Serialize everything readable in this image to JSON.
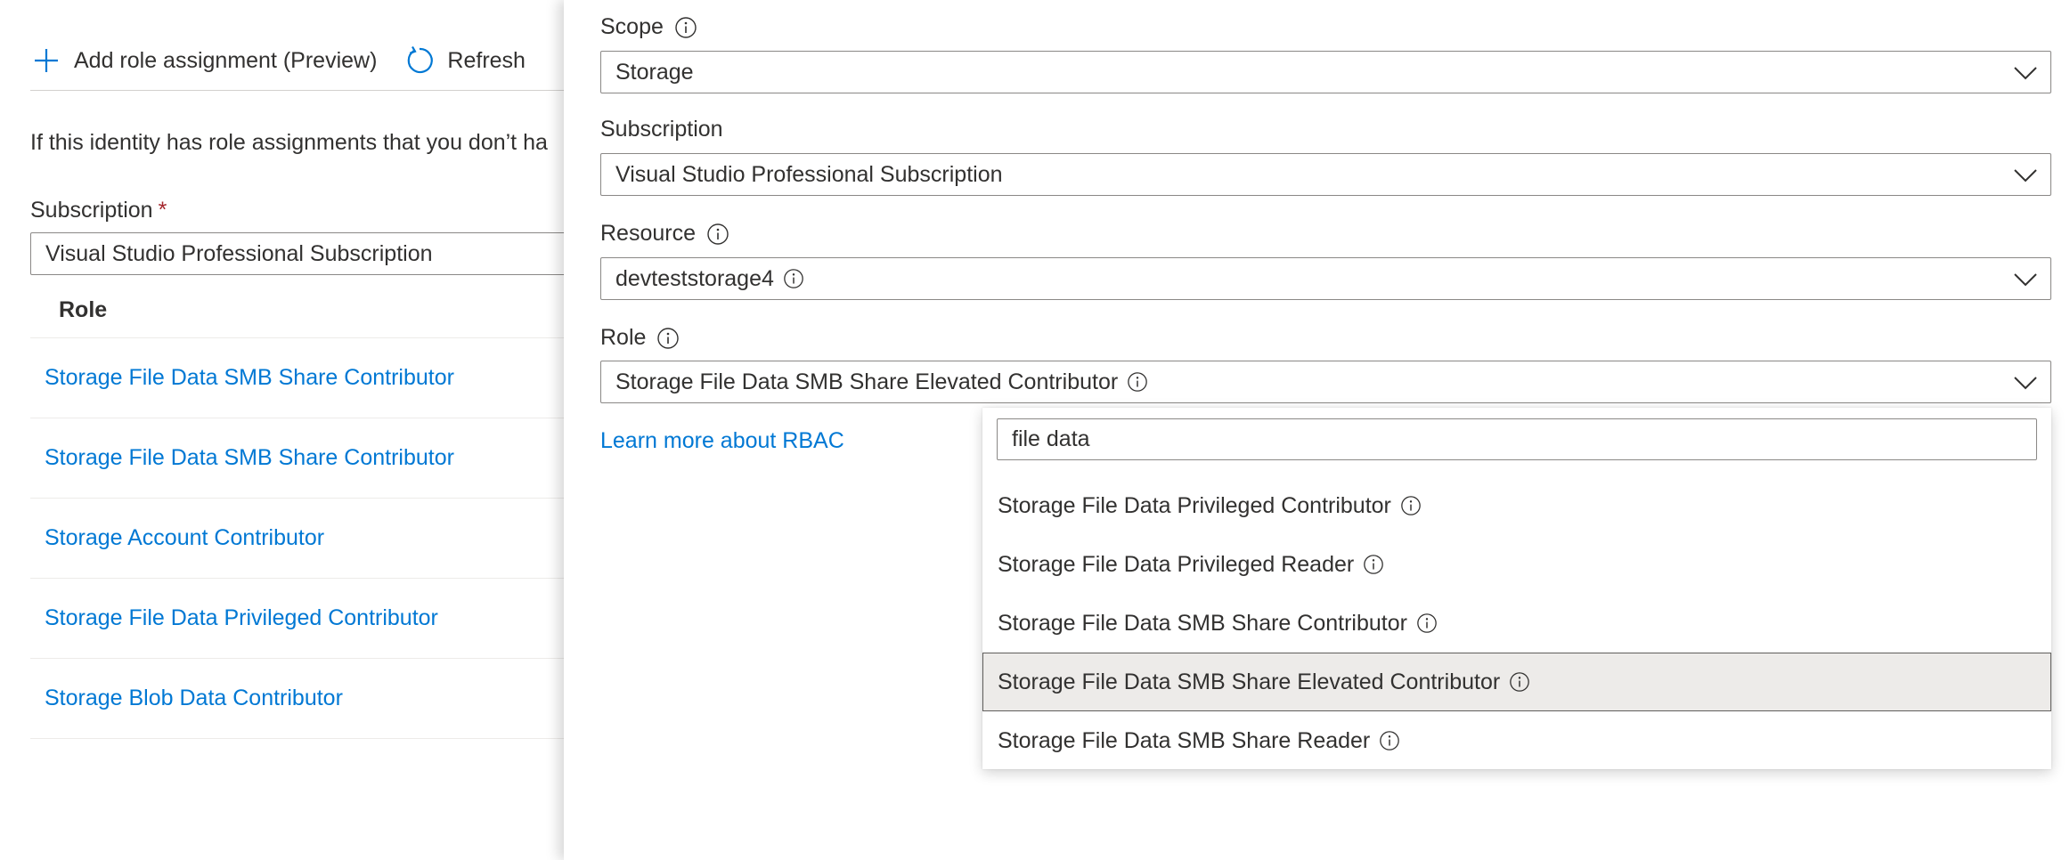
{
  "toolbar": {
    "add_label": "Add role assignment (Preview)",
    "refresh_label": "Refresh"
  },
  "left": {
    "info_text": "If this identity has role assignments that you don’t ha",
    "subscription_label": "Subscription",
    "required_marker": "*",
    "subscription_value": "Visual Studio Professional Subscription",
    "table_header": "Role",
    "rows": [
      "Storage File Data SMB Share Contributor",
      "Storage File Data SMB Share Contributor",
      "Storage Account Contributor",
      "Storage File Data Privileged Contributor",
      "Storage Blob Data Contributor"
    ]
  },
  "panel": {
    "scope_label": "Scope",
    "scope_value": "Storage",
    "subscription_label": "Subscription",
    "subscription_value": "Visual Studio Professional Subscription",
    "resource_label": "Resource",
    "resource_value": "devteststorage4",
    "role_label": "Role",
    "role_value": "Storage File Data SMB Share Elevated Contributor",
    "learn_more": "Learn more about RBAC"
  },
  "role_dropdown": {
    "search_value": "file data",
    "options": [
      "Storage File Data Privileged Contributor",
      "Storage File Data Privileged Reader",
      "Storage File Data SMB Share Contributor",
      "Storage File Data SMB Share Elevated Contributor",
      "Storage File Data SMB Share Reader"
    ],
    "selected_option": "Storage File Data SMB Share Elevated Contributor"
  },
  "icons": {
    "add": "plus-icon",
    "refresh": "refresh-icon",
    "info": "info-icon",
    "dropdown": "chevron-down-icon"
  },
  "colors": {
    "accent": "#0078d4",
    "required": "#a4262c",
    "text": "#323130",
    "border": "#8a8886",
    "selected_bg": "#edebe9"
  }
}
